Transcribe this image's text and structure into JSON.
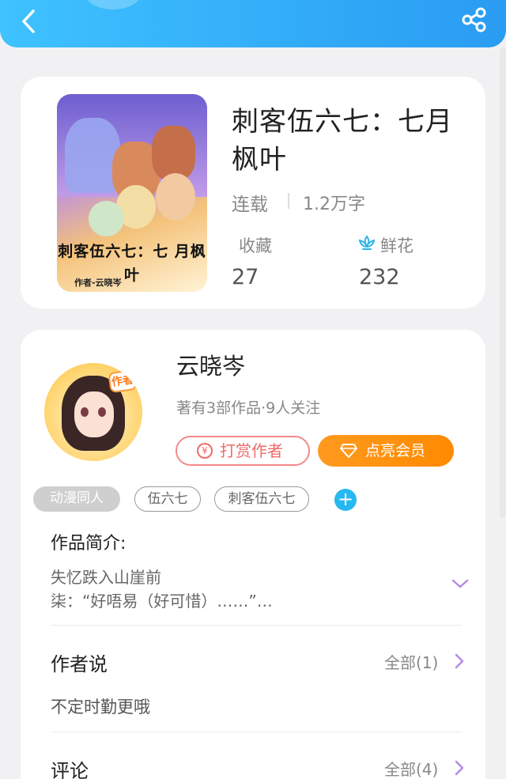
{
  "header": {
    "back_icon": "chevron-left-icon",
    "share_icon": "share-icon",
    "gradient_colors": [
      "#3fc2ff",
      "#2a9cf2"
    ]
  },
  "book": {
    "cover_title": "刺客伍六七：七 月枫叶",
    "cover_author": "作者-云晓岑",
    "title": "刺客伍六七：七月枫叶",
    "status": "连载",
    "word_count": "1.2万字",
    "favorites_label": "收藏",
    "favorites_count": "27",
    "flowers_label": "鲜花",
    "flowers_count": "232",
    "flower_icon": "lotus-flower-icon"
  },
  "author": {
    "badge": "作者",
    "name": "云晓岑",
    "meta": "著有3部作品·9人关注",
    "reward_label": "打赏作者",
    "reward_icon": "yen-coin-icon",
    "vip_label": "点亮会员",
    "vip_icon": "diamond-icon",
    "accent_color": "#ff8a00"
  },
  "tags": [
    "动漫同人",
    "伍六七",
    "刺客伍六七"
  ],
  "intro": {
    "heading": "作品简介:",
    "line1": "失忆跌入山崖前",
    "line2": "柒：“好唔易（好可惜）……”…"
  },
  "author_say": {
    "title": "作者说",
    "view_all": "全部(1)",
    "text": "不定时勤更哦"
  },
  "comments": {
    "title": "评论",
    "view_all": "全部(4)"
  }
}
